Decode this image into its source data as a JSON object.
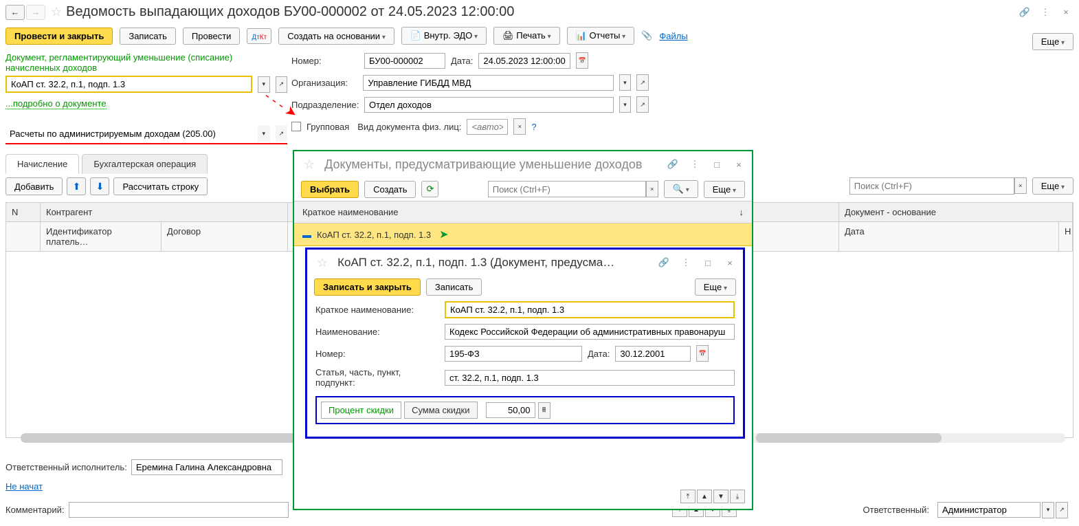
{
  "header": {
    "title": "Ведомость выпадающих доходов БУ00-000002 от 24.05.2023 12:00:00"
  },
  "toolbar": {
    "post_close": "Провести и закрыть",
    "save": "Записать",
    "post": "Провести",
    "create_based": "Создать на основании",
    "edo": "Внутр. ЭДО",
    "print": "Печать",
    "reports": "Отчеты",
    "files": "Файлы",
    "more": "Еще"
  },
  "left": {
    "doc_label": "Документ, регламентирующий уменьшение (списание) начисленных доходов",
    "doc_value": "КоАП ст. 32.2, п.1, подп. 1.3",
    "doc_detail": "...подробно о документе",
    "account_value": "Расчеты по администрируемым доходам (205.00)"
  },
  "right": {
    "number_lbl": "Номер:",
    "number_val": "БУ00-000002",
    "date_lbl": "Дата:",
    "date_val": "24.05.2023 12:00:00",
    "org_lbl": "Организация:",
    "org_val": "Управление ГИБДД МВД",
    "dept_lbl": "Подразделение:",
    "dept_val": "Отдел доходов",
    "group_lbl": "Групповая",
    "kind_lbl": "Вид документа физ. лиц:",
    "kind_ph": "<авто>"
  },
  "tabs": {
    "t1": "Начисление",
    "t2": "Бухгалтерская операция"
  },
  "subtoolbar": {
    "add": "Добавить",
    "calc": "Рассчитать строку"
  },
  "table": {
    "n": "N",
    "c1": "Контрагент",
    "c2": "Идентификатор платель…",
    "c3": "Договор",
    "c4": "Документ - основание",
    "c5": "Дата",
    "c6": "Н"
  },
  "search_ph": "Поиск (Ctrl+F)",
  "footer": {
    "resp_lbl": "Ответственный исполнитель:",
    "resp_val": "Еремина Галина Александровна",
    "not_started": "Не начат",
    "comment_lbl": "Комментарий:",
    "resp2_lbl": "Ответственный:",
    "resp2_val": "Администратор"
  },
  "modal1": {
    "title": "Документы, предусматривающие уменьшение доходов",
    "select": "Выбрать",
    "create": "Создать",
    "more": "Еще",
    "col": "Краткое наименование",
    "row": "КоАП ст. 32.2, п.1, подп. 1.3"
  },
  "modal2": {
    "title": "КоАП ст. 32.2, п.1, подп. 1.3 (Документ, предусма…",
    "save_close": "Записать и закрыть",
    "save": "Записать",
    "more": "Еще",
    "f1_lbl": "Краткое наименование:",
    "f1_val": "КоАП ст. 32.2, п.1, подп. 1.3",
    "f2_lbl": "Наименование:",
    "f2_val": "Кодекс Российской Федерации об административных правонаруш",
    "f3_lbl": "Номер:",
    "f3_val": "195-ФЗ",
    "f4_lbl": "Дата:",
    "f4_val": "30.12.2001",
    "f5_lbl": "Статья, часть, пункт, подпункт:",
    "f5_val": "ст. 32.2, п.1, подп. 1.3",
    "disc_pct": "Процент скидки",
    "disc_sum": "Сумма скидки",
    "disc_val": "50,00"
  }
}
